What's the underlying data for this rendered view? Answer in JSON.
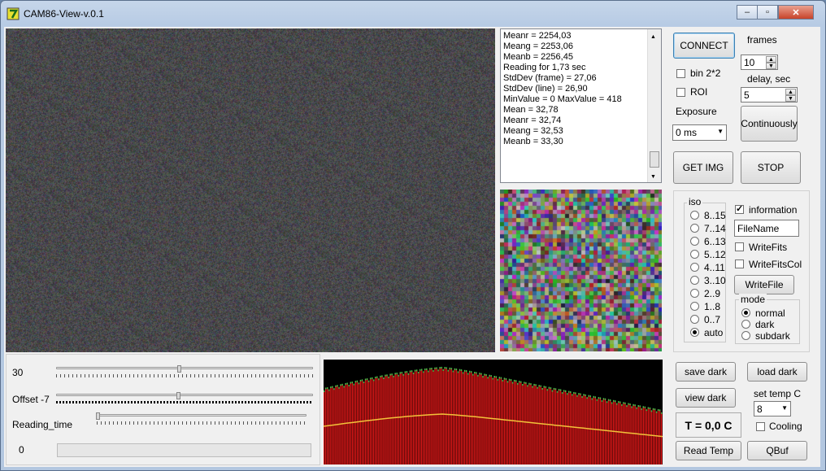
{
  "window": {
    "title": "CAM86-View-v.0.1",
    "minimize": "–",
    "restore": "▫",
    "close": "✕"
  },
  "log": {
    "lines": [
      "Meanr = 2254,03",
      "Meang = 2253,06",
      "Meanb = 2256,45",
      "",
      "Reading for 1,73 sec",
      "StdDev (frame) = 27,06",
      "StdDev (line) = 26,90",
      "MinValue = 0 MaxValue = 418",
      "Mean = 32,78",
      "Meanr = 32,74",
      "Meang = 32,53",
      "Meanb = 33,30"
    ]
  },
  "controls": {
    "connect": "CONNECT",
    "frames_label": "frames",
    "frames_value": "10",
    "bin_label": "bin 2*2",
    "roi_label": "ROI",
    "delay_label": "delay, sec",
    "delay_value": "5",
    "exposure_label": "Exposure",
    "exposure_value": "0 ms",
    "continuously": "Continuously",
    "get_img": "GET IMG",
    "stop": "STOP"
  },
  "iso": {
    "title": "iso",
    "options": [
      "8..15",
      "7..14",
      "6..13",
      "5..12",
      "4..11",
      "3..10",
      "2..9",
      "1..8",
      "0..7",
      "auto"
    ],
    "selected": "auto"
  },
  "output": {
    "information_label": "information",
    "information_checked": true,
    "filename_value": "FileName",
    "writefits_label": "WriteFits",
    "writefitscol_label": "WriteFitsCol",
    "writefile": "WriteFile",
    "mode_title": "mode",
    "modes": [
      "normal",
      "dark",
      "subdark"
    ],
    "mode_selected": "normal"
  },
  "sliders": {
    "gain_label": "30",
    "offset_label": "Offset -7",
    "reading_time_label": "Reading_time",
    "progress_label": "0",
    "progress": 0
  },
  "dark": {
    "save_dark": "save dark",
    "load_dark": "load dark",
    "view_dark": "view dark",
    "set_temp_label": "set temp C",
    "set_temp_value": "8",
    "temperature": "T = 0,0 C",
    "cooling_label": "Cooling",
    "read_temp": "Read Temp",
    "qbuf": "QBuf"
  },
  "colors": {
    "histogram_bg": "#000000",
    "histogram_bar": "#e01818",
    "histogram_top": "#4cc24c"
  }
}
